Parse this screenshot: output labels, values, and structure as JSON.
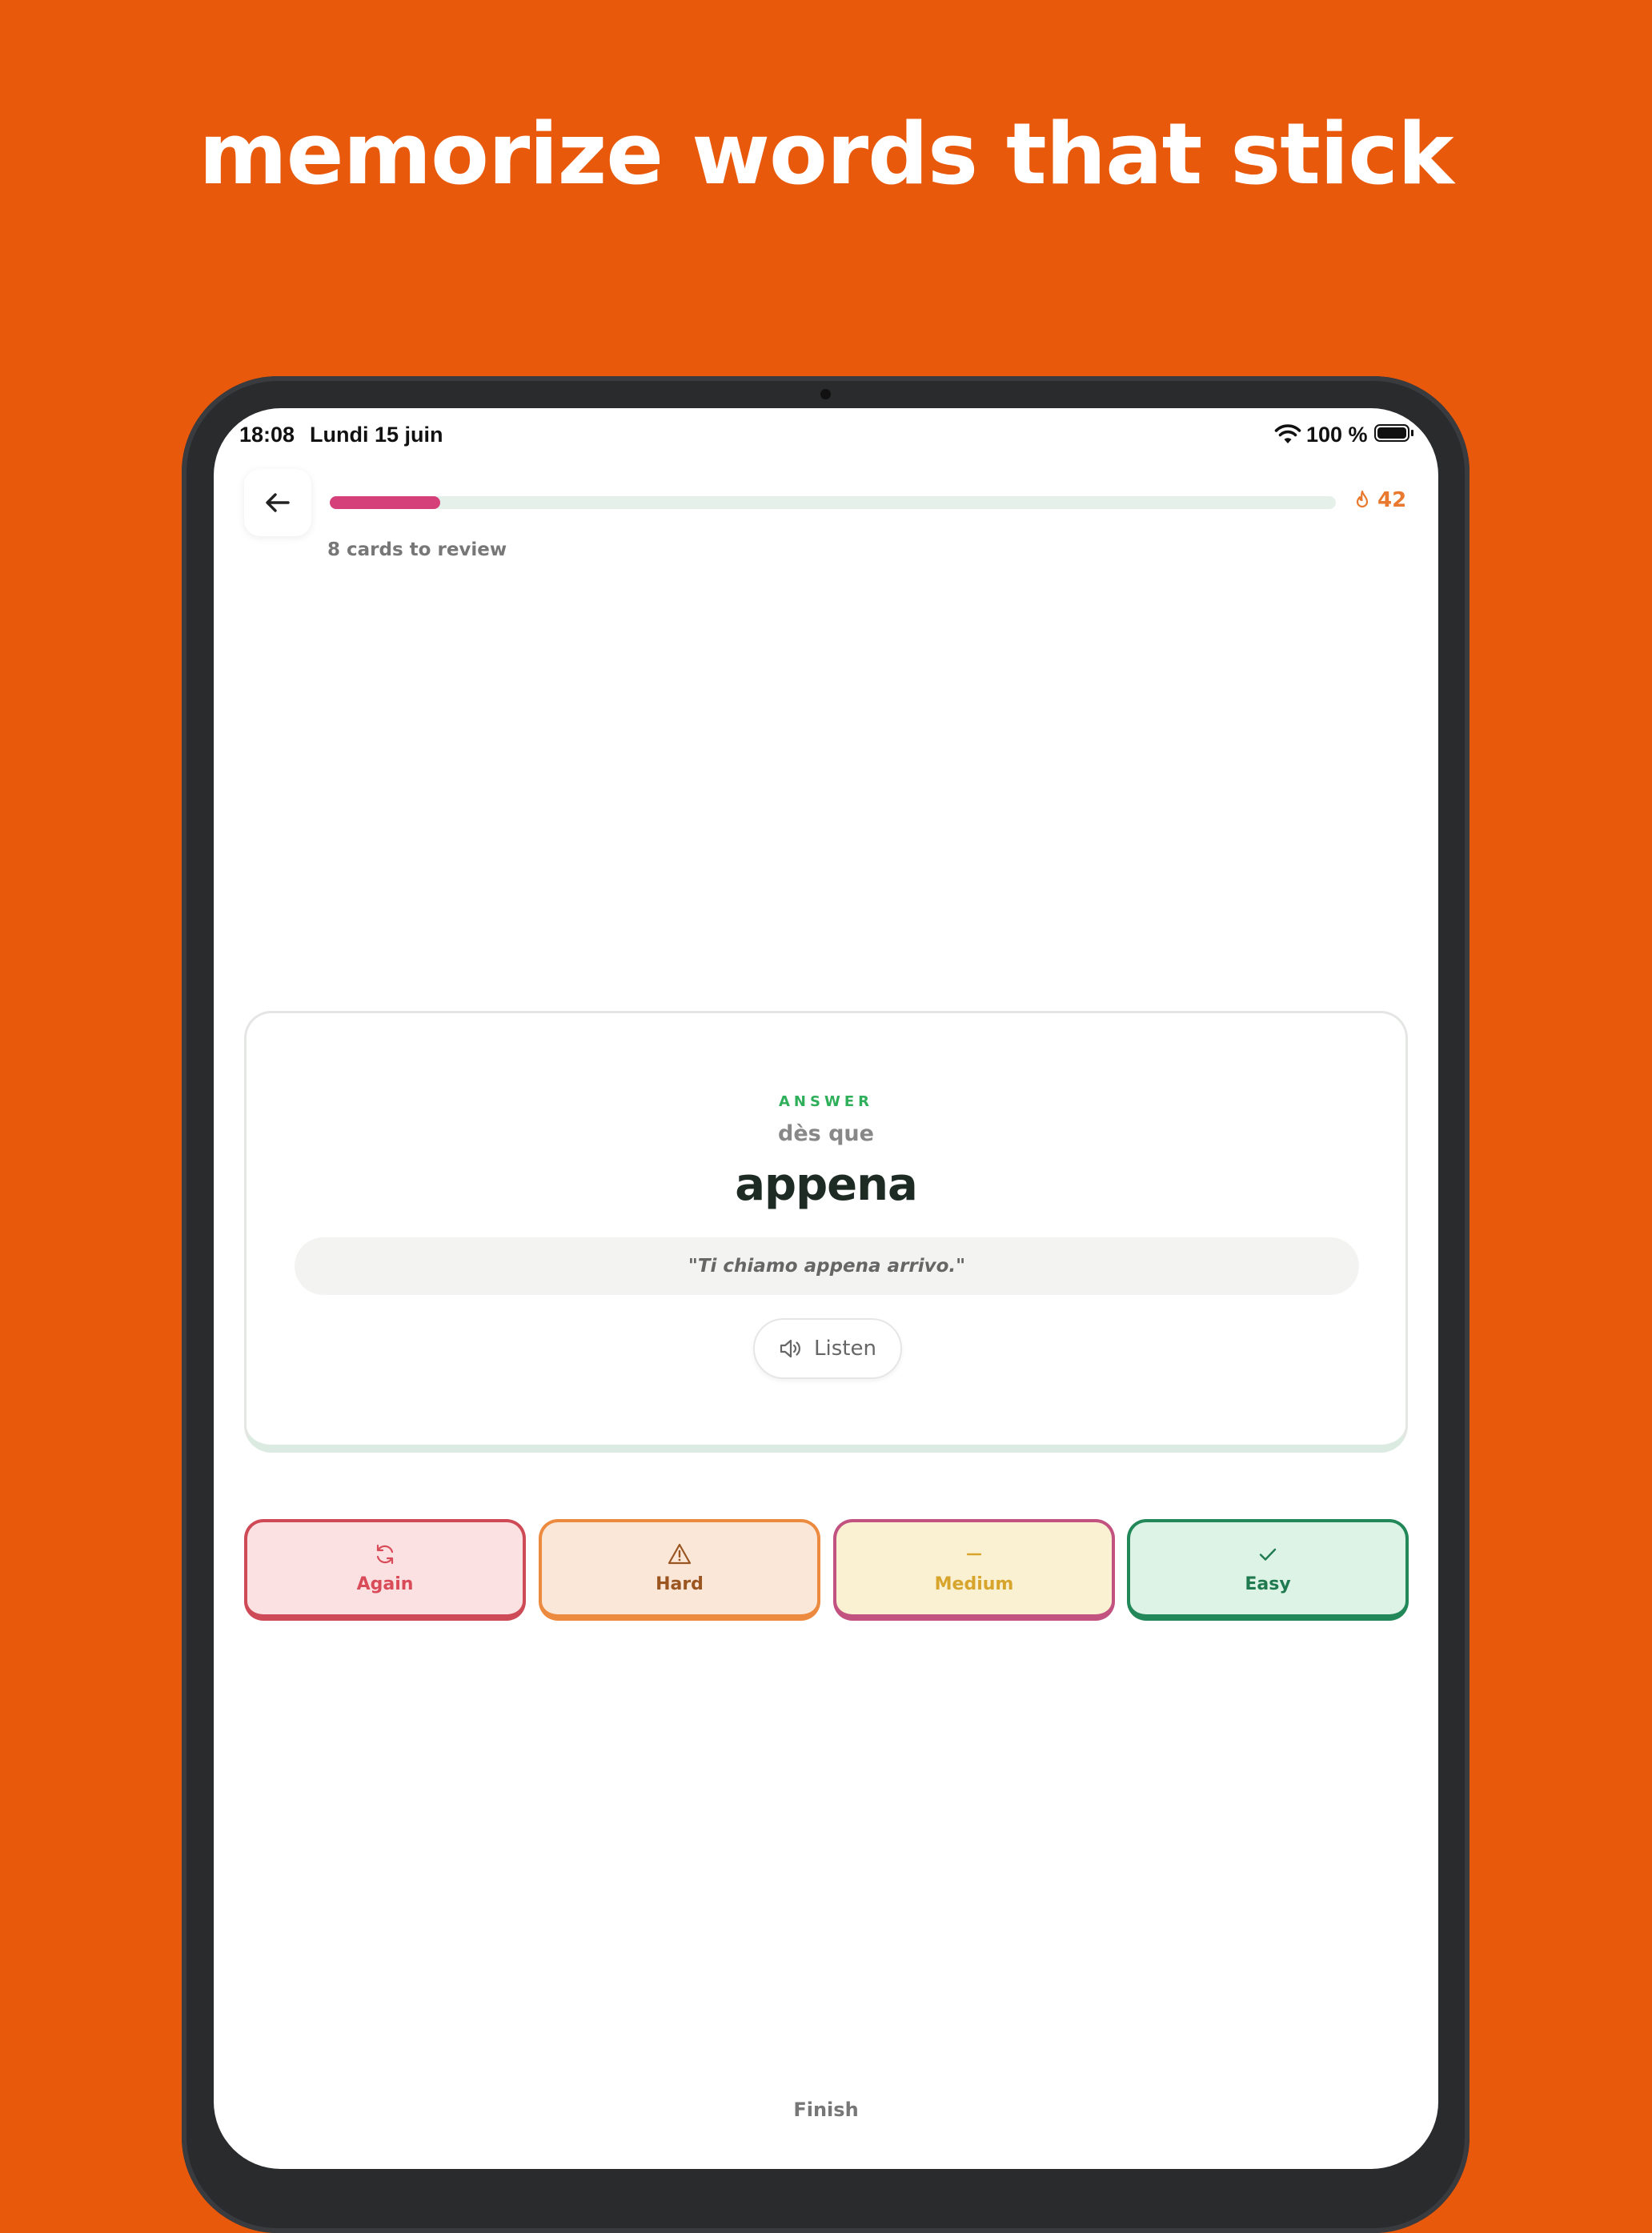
{
  "headline": "memorize words that stick",
  "status_bar": {
    "time": "18:08",
    "date": "Lundi 15 juin",
    "battery": "100 %"
  },
  "header": {
    "progress_fraction": 0.11,
    "streak_count": "42",
    "cards_left": "8 cards to review"
  },
  "card": {
    "label": "ANSWER",
    "prompt": "dès que",
    "answer": "appena",
    "example": "\"Ti chiamo appena arrivo.\"",
    "listen_label": "Listen"
  },
  "grades": [
    {
      "label": "Again",
      "icon": "refresh-icon"
    },
    {
      "label": "Hard",
      "icon": "warning-triangle-icon"
    },
    {
      "label": "Medium",
      "icon": "dash-icon"
    },
    {
      "label": "Easy",
      "icon": "check-icon"
    }
  ],
  "footer": {
    "finish_label": "Finish"
  },
  "colors": {
    "background": "#E8590C",
    "progress": "#D6407A",
    "answer_label": "#2FAF5A",
    "streak": "#E8792F"
  }
}
